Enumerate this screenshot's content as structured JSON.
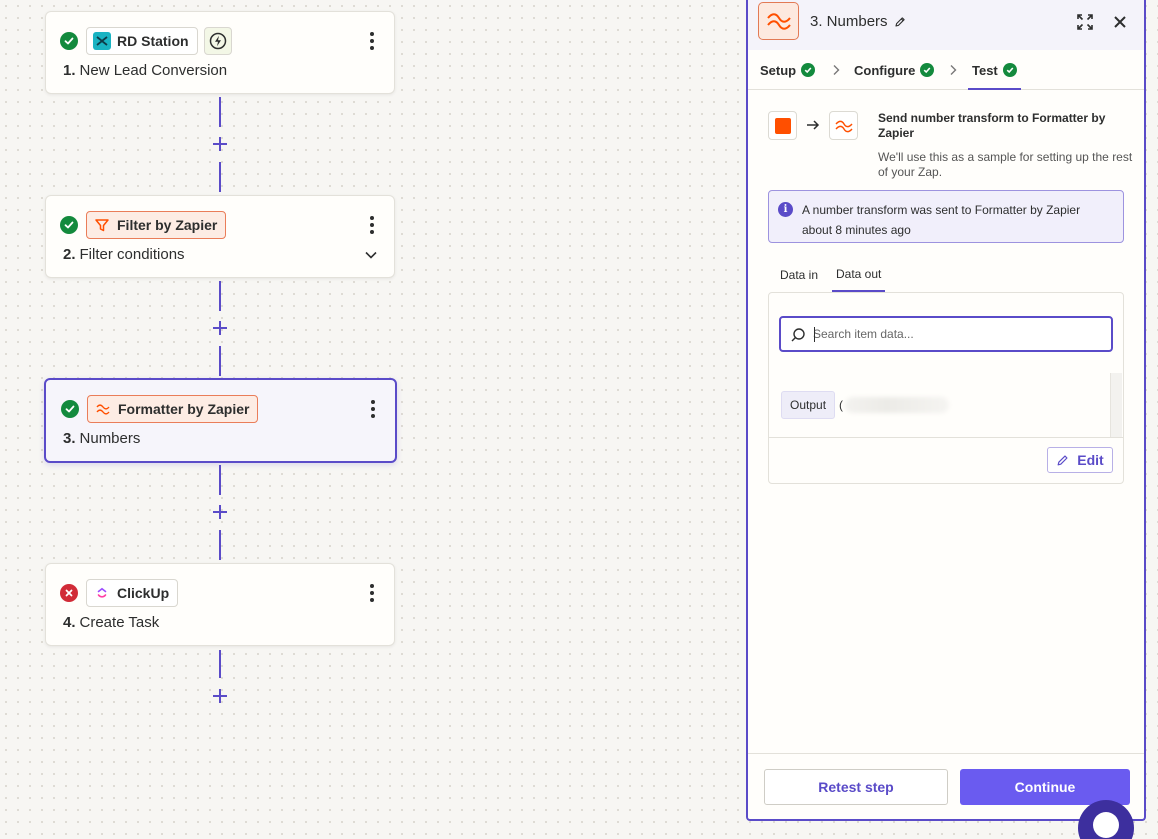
{
  "steps": [
    {
      "status": "ok",
      "app": "RD Station",
      "number": "1.",
      "title": "New Lead Conversion",
      "instant": true
    },
    {
      "status": "ok",
      "app": "Filter by Zapier",
      "number": "2.",
      "title": "Filter conditions",
      "expandable": true
    },
    {
      "status": "ok",
      "app": "Formatter by Zapier",
      "number": "3.",
      "title": "Numbers",
      "selected": true
    },
    {
      "status": "error",
      "app": "ClickUp",
      "number": "4.",
      "title": "Create Task"
    }
  ],
  "panel": {
    "title": "3. Numbers",
    "tabs": [
      {
        "label": "Setup",
        "complete": true
      },
      {
        "label": "Configure",
        "complete": true
      },
      {
        "label": "Test",
        "complete": true,
        "active": true
      }
    ],
    "send_title": "Send number transform to Formatter by Zapier",
    "send_subtitle": "We'll use this as a sample for setting up the rest of your Zap.",
    "info_line1": "A number transform was sent to Formatter by Zapier",
    "info_line2": "about 8 minutes ago",
    "data_tabs": [
      "Data in",
      "Data out"
    ],
    "active_data_tab": "Data out",
    "search_placeholder": "Search item data...",
    "output_label": "Output",
    "output_prefix": "(",
    "edit_label": "Edit",
    "retest_label": "Retest step",
    "continue_label": "Continue"
  },
  "colors": {
    "accent": "#5a4bc8",
    "primary_button": "#6a5bf0",
    "success": "#138a3d",
    "error": "#d12b37",
    "zapier_orange": "#ff4f00"
  }
}
